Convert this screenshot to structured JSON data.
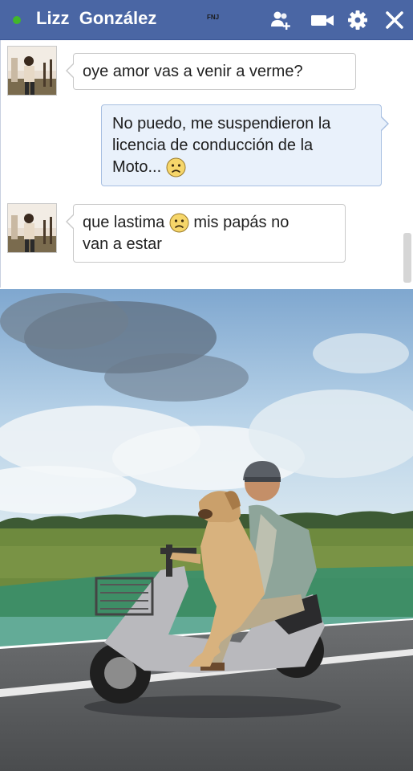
{
  "header": {
    "contact_name": "Lizz  González",
    "watermark": "FNJ",
    "status": "online",
    "accent_color": "#4a66a4",
    "status_color": "#42b72a",
    "icons": [
      "add-friend-icon",
      "video-call-icon",
      "gear-icon",
      "close-icon"
    ]
  },
  "messages": [
    {
      "sender": "contact",
      "text": "oye amor vas a venir a verme?"
    },
    {
      "sender": "me",
      "text_line1": "No puedo, me suspendieron la",
      "text_line2": "licencia de conducción de la",
      "text_line3": "Moto...",
      "emoji": "sad-emoji"
    },
    {
      "sender": "contact",
      "text_part1": "que lastima",
      "emoji": "sad-emoji",
      "text_part2": " mis papás no",
      "text_line2": "van a estar"
    }
  ],
  "photo": {
    "description_icon": "photo-man-dog-scooter",
    "sky_color": "#9fc3e0",
    "grass_color": "#6e8a3e",
    "road_color": "#5c5e60"
  }
}
